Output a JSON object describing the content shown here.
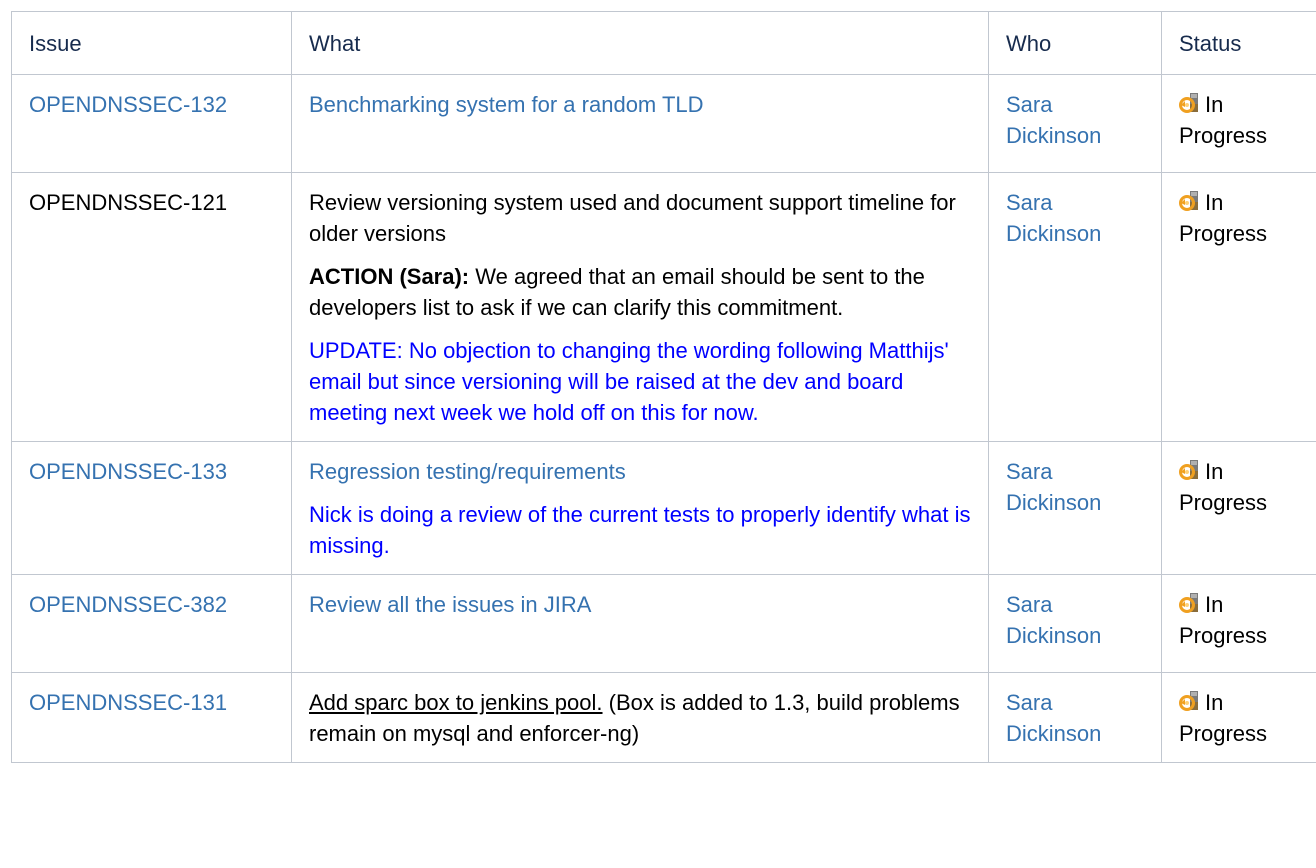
{
  "table": {
    "headers": {
      "issue": "Issue",
      "what": "What",
      "who": "Who",
      "status": "Status"
    },
    "rows": [
      {
        "issue": "OPENDNSSEC-132",
        "what": "Benchmarking system for a random TLD",
        "who_first": "Sara",
        "who_last": "Dickinson",
        "status_word1": "In",
        "status_word2": "Progress",
        "status_icon": "in-progress-icon"
      },
      {
        "issue": "OPENDNSSEC-121",
        "what": "Review versioning system used and document support timeline for older versions",
        "action_label": "ACTION (Sara):",
        "action_text": " We agreed that an email should be sent to the developers list to ask if we can clarify this commitment.",
        "update_text": "UPDATE: No objection to changing the wording following Matthijs' email but since versioning will be raised at the dev and board meeting next week we hold off on this for now.",
        "who_first": "Sara",
        "who_last": "Dickinson",
        "status_word1": "In",
        "status_word2": "Progress",
        "status_icon": "in-progress-icon"
      },
      {
        "issue": "OPENDNSSEC-133",
        "what": "Regression testing/requirements",
        "note": "Nick is doing a review of the current tests to properly identify what is missing.",
        "who_first": "Sara",
        "who_last": "Dickinson",
        "status_word1": "In",
        "status_word2": "Progress",
        "status_icon": "in-progress-icon"
      },
      {
        "issue": "OPENDNSSEC-382",
        "what": "Review all the issues in JIRA",
        "who_first": "Sara",
        "who_last": "Dickinson",
        "status_word1": "In",
        "status_word2": "Progress",
        "status_icon": "in-progress-icon"
      },
      {
        "issue": "OPENDNSSEC-131",
        "what_underlined": "Add sparc box to jenkins pool.",
        "what_rest": " (Box is added to 1.3, build problems remain on mysql and enforcer-ng)",
        "who_first": "Sara",
        "who_last": "Dickinson",
        "status_word1": "In",
        "status_word2": "Progress",
        "status_icon": "in-progress-icon"
      }
    ]
  },
  "colors": {
    "link": "#3572b0",
    "update_blue": "#0000ff",
    "border": "#c1c7d0",
    "icon_orange": "#f0a020"
  }
}
